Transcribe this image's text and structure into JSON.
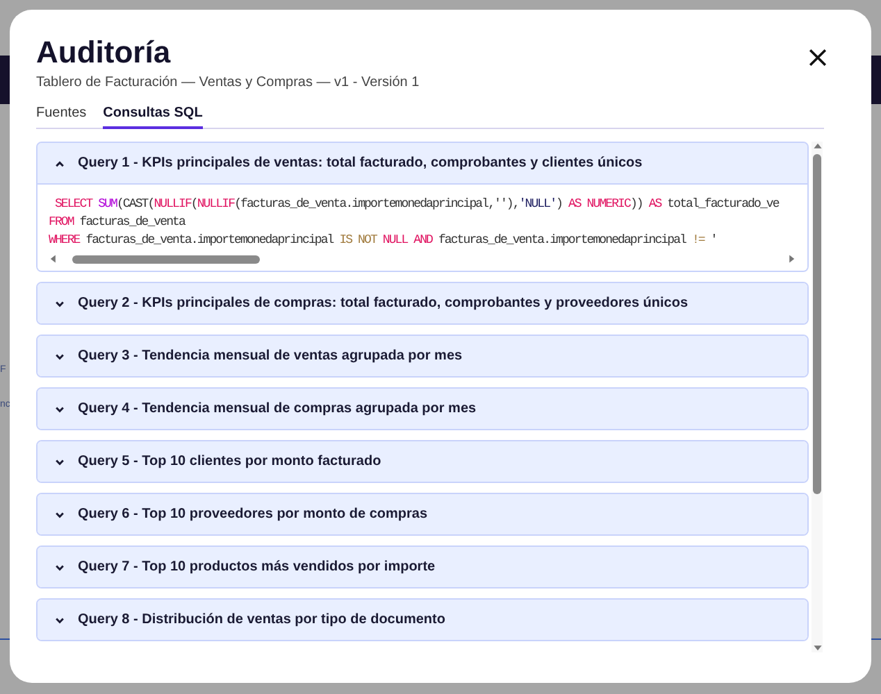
{
  "background": {
    "fragments": [
      "F",
      "nc"
    ]
  },
  "dialog": {
    "title": "Auditoría",
    "subtitle": "Tablero de Facturación — Ventas y Compras — v1 - Versión 1"
  },
  "tabs": [
    {
      "label": "Fuentes",
      "selected": false
    },
    {
      "label": "Consultas SQL",
      "selected": true
    }
  ],
  "queries": [
    {
      "title": "Query 1 - KPIs principales de ventas: total facturado, comprobantes y clientes únicos",
      "expanded": true,
      "sql_lines": [
        [
          {
            "kind": "keyword",
            "text": " SELECT"
          },
          {
            "kind": "function",
            "text": " SUM"
          },
          {
            "kind": "plain",
            "text": "(CAST("
          },
          {
            "kind": "keyword",
            "text": "NULLIF"
          },
          {
            "kind": "plain",
            "text": "("
          },
          {
            "kind": "keyword",
            "text": "NULLIF"
          },
          {
            "kind": "plain",
            "text": "(facturas_de_venta.importemonedaprincipal,''),"
          },
          {
            "kind": "string",
            "text": "'NULL'"
          },
          {
            "kind": "plain",
            "text": ") "
          },
          {
            "kind": "keyword",
            "text": "AS NUMERIC"
          },
          {
            "kind": "plain",
            "text": ")) "
          },
          {
            "kind": "keyword",
            "text": "AS"
          },
          {
            "kind": "plain",
            "text": " total_facturado_ve"
          }
        ],
        [
          {
            "kind": "keyword",
            "text": "FROM"
          },
          {
            "kind": "plain",
            "text": " facturas_de_venta"
          }
        ],
        [
          {
            "kind": "keyword",
            "text": "WHERE"
          },
          {
            "kind": "plain",
            "text": " facturas_de_venta.importemonedaprincipal "
          },
          {
            "kind": "operator",
            "text": "IS NOT"
          },
          {
            "kind": "keyword",
            "text": " NULL"
          },
          {
            "kind": "keyword",
            "text": " AND"
          },
          {
            "kind": "plain",
            "text": " facturas_de_venta.importemonedaprincipal "
          },
          {
            "kind": "operator",
            "text": "!="
          },
          {
            "kind": "plain",
            "text": " '"
          }
        ]
      ]
    },
    {
      "title": "Query 2 - KPIs principales de compras: total facturado, comprobantes y proveedores únicos",
      "expanded": false
    },
    {
      "title": "Query 3 - Tendencia mensual de ventas agrupada por mes",
      "expanded": false
    },
    {
      "title": "Query 4 - Tendencia mensual de compras agrupada por mes",
      "expanded": false
    },
    {
      "title": "Query 5 - Top 10 clientes por monto facturado",
      "expanded": false
    },
    {
      "title": "Query 6 - Top 10 proveedores por monto de compras",
      "expanded": false
    },
    {
      "title": "Query 7 - Top 10 productos más vendidos por importe",
      "expanded": false
    },
    {
      "title": "Query 8 - Distribución de ventas por tipo de documento",
      "expanded": false
    }
  ]
}
